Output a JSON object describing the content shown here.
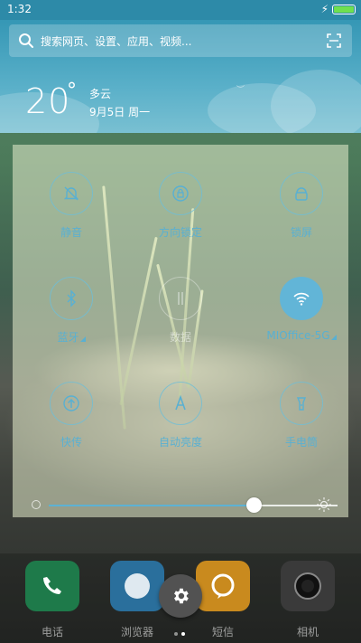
{
  "status_bar": {
    "time": "1:32",
    "battery_level": 1.0,
    "battery_color": "#6fe04f"
  },
  "search": {
    "placeholder": "搜索网页、设置、应用、视频..."
  },
  "weather": {
    "temperature": "20",
    "degree_symbol": "°",
    "condition": "多云",
    "date": "9月5日 周一"
  },
  "quick_settings": {
    "tiles": [
      {
        "label": "静音",
        "icon": "bell-off-icon",
        "on": false
      },
      {
        "label": "方向锁定",
        "icon": "rotation-lock-icon",
        "on": false
      },
      {
        "label": "锁屏",
        "icon": "lock-icon",
        "on": false
      },
      {
        "label": "蓝牙",
        "icon": "bluetooth-icon",
        "on": false
      },
      {
        "label": "数据",
        "icon": "mobile-data-icon",
        "on": false,
        "disabled": true
      },
      {
        "label": "MIOffice-5G",
        "icon": "wifi-icon",
        "on": true
      },
      {
        "label": "快传",
        "icon": "share-transfer-icon",
        "on": false
      },
      {
        "label": "自动亮度",
        "icon": "auto-brightness-icon",
        "on": false
      },
      {
        "label": "手电筒",
        "icon": "flashlight-icon",
        "on": false
      }
    ],
    "brightness": 0.71,
    "accent_color": "#62b5d7"
  },
  "dock": {
    "apps": [
      {
        "name": "电话",
        "icon": "phone-icon",
        "color": "#1e7a4a"
      },
      {
        "name": "浏览器",
        "icon": "browser-icon",
        "color": "#2a6f9c"
      },
      {
        "name": "短信",
        "icon": "message-icon",
        "color": "#c98a1e"
      },
      {
        "name": "相机",
        "icon": "camera-icon",
        "color": "#3a3a3a"
      }
    ],
    "settings_icon": "gear-icon",
    "page_count": 2,
    "active_page": 1
  }
}
